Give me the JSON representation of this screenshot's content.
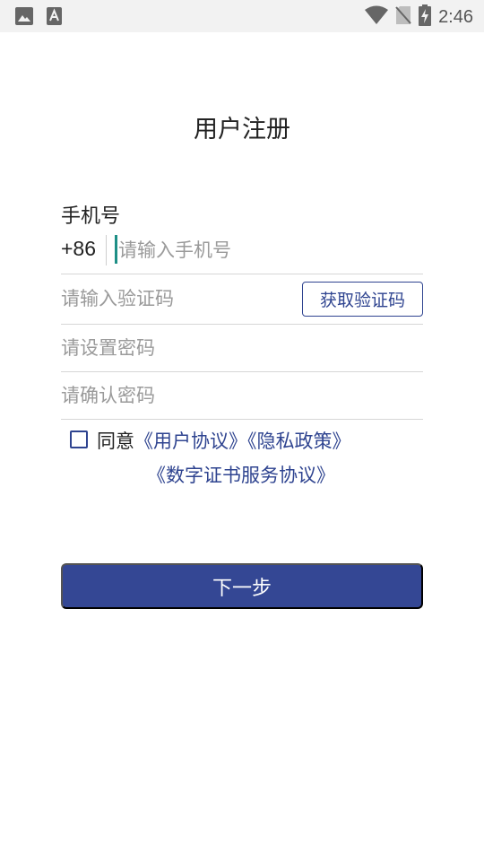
{
  "status_bar": {
    "time": "2:46",
    "icons": [
      "image-icon",
      "text-a-icon",
      "wifi-icon",
      "no-sim-icon",
      "battery-charging-icon"
    ]
  },
  "page": {
    "title": "用户注册"
  },
  "form": {
    "phone_label": "手机号",
    "country_code": "+86",
    "phone_placeholder": "请输入手机号",
    "code_placeholder": "请输入验证码",
    "get_code_label": "获取验证码",
    "password_placeholder": "请设置密码",
    "confirm_placeholder": "请确认密码"
  },
  "agreement": {
    "checked": false,
    "prefix": "同意",
    "user_agreement": "《用户协议》",
    "privacy_policy": "《隐私政策》",
    "certificate_agreement": "《数字证书服务协议》"
  },
  "actions": {
    "next_label": "下一步"
  },
  "colors": {
    "accent": "#344794",
    "link": "#2f4490",
    "caret": "#1e8f86"
  }
}
